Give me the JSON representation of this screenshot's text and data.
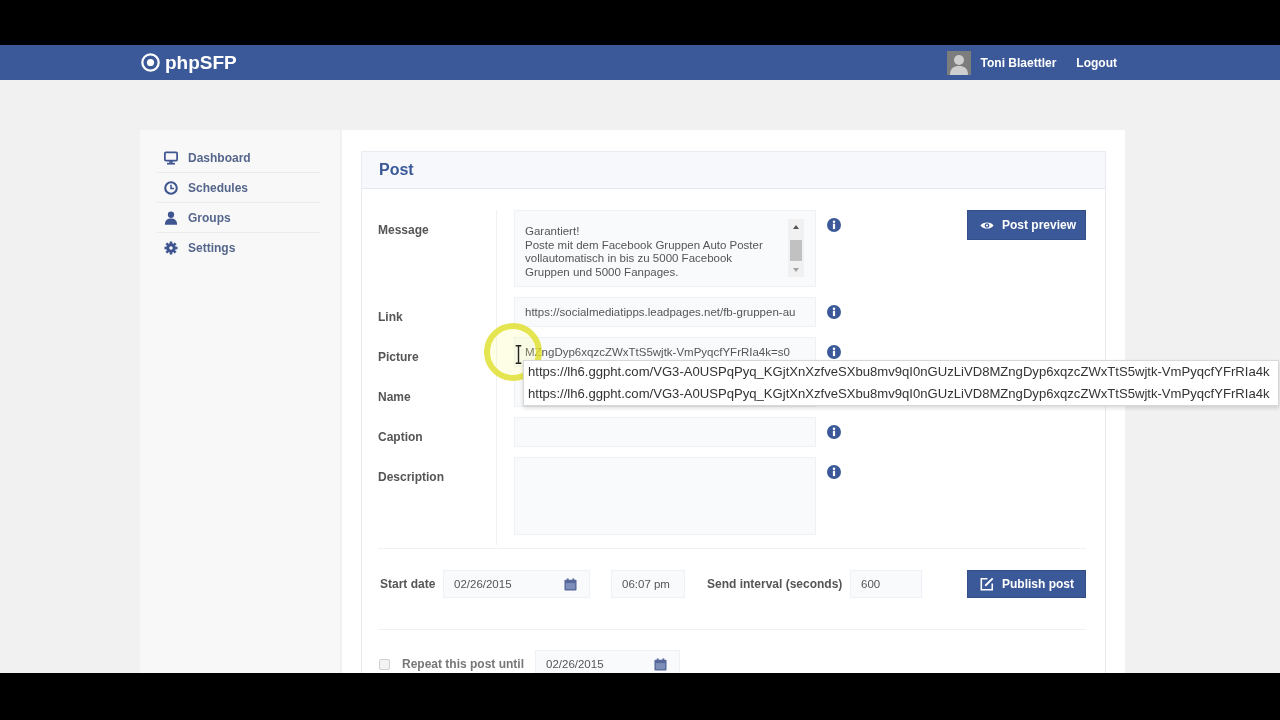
{
  "navbar": {
    "brand": "phpSFP",
    "user": "Toni Blaettler",
    "logout": "Logout"
  },
  "sidebar": {
    "items": [
      {
        "label": "Dashboard",
        "selected": false
      },
      {
        "label": "Schedules",
        "selected": false
      },
      {
        "label": "Groups",
        "selected": false
      },
      {
        "label": "Settings",
        "selected": false
      }
    ]
  },
  "panel": {
    "title": "Post"
  },
  "fields": [
    {
      "kind": "textarea",
      "label": "Message",
      "value": "Garantiert!\nPoste mit dem Facebook Gruppen Auto Poster vollautomatisch in bis zu 5000 Facebook Gruppen und 5000 Fanpages."
    },
    {
      "kind": "input",
      "label": "Link",
      "value": "https://socialmediatipps.leadpages.net/fb-gruppen-au"
    },
    {
      "kind": "input",
      "label": "Picture",
      "value": "MZngDyp6xqzcZWxTtS5wjtk-VmPyqcfYFrRIa4k=s0",
      "suggestions": [
        "https://lh6.ggpht.com/VG3-A0USPqPyq_KGjtXnXzfveSXbu8mv9qI0nGUzLiVD8MZngDyp6xqzcZWxTtS5wjtk-VmPyqcfYFrRIa4k",
        "https://lh6.ggpht.com/VG3-A0USPqPyq_KGjtXnXzfveSXbu8mv9qI0nGUzLiVD8MZngDyp6xqzcZWxTtS5wjtk-VmPyqcfYFrRIa4k"
      ]
    },
    {
      "kind": "input",
      "label": "Name"
    },
    {
      "kind": "input",
      "label": "Caption"
    },
    {
      "kind": "textarea",
      "label": "Description"
    }
  ],
  "preview_button": {
    "label": "Post preview"
  },
  "schedule": {
    "label": "Start date",
    "date": "02/26/2015",
    "time": "06:07 pm",
    "interval_label": "Send interval (seconds)",
    "interval": "600"
  },
  "publish_button": {
    "label": "Publish post"
  },
  "repeat": {
    "label": "Repeat this post until",
    "checked": false,
    "until_date": "02/26/2015"
  }
}
